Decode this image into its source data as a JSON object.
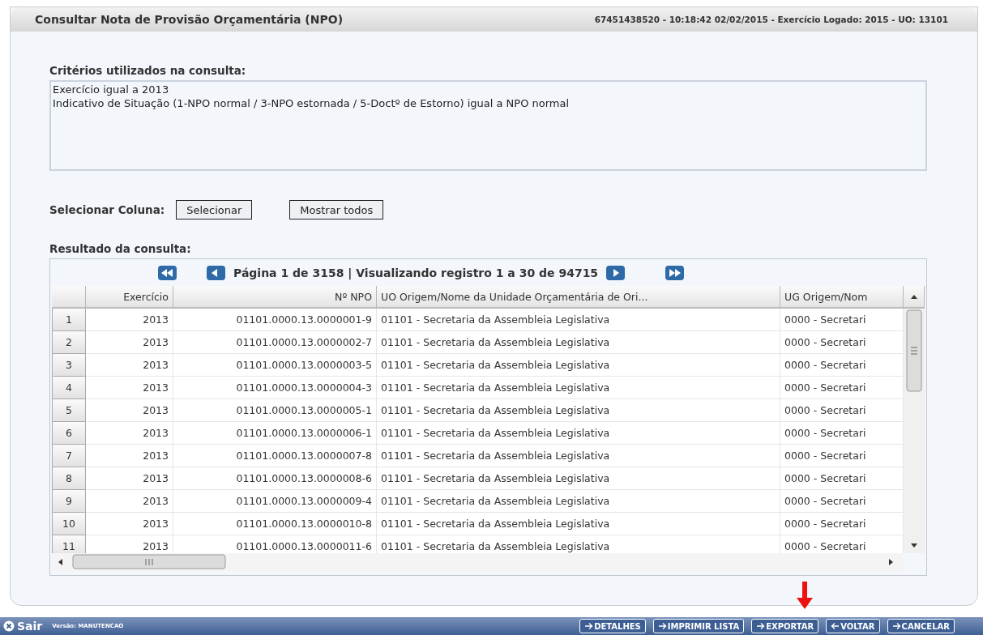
{
  "header": {
    "title": "Consultar Nota de Provisão Orçamentária (NPO)",
    "info": "67451438520 - 10:18:42 02/02/2015 - Exercício Logado: 2015 - UO: 13101"
  },
  "criteria": {
    "label": "Critérios utilizados na consulta:",
    "lines": [
      "Exercício igual a 2013",
      "Indicativo de Situação (1-NPO normal / 3-NPO estornada / 5-Doctº de Estorno) igual a NPO normal"
    ]
  },
  "column_select": {
    "label": "Selecionar Coluna:",
    "buttons": [
      "Selecionar",
      "Mostrar todos"
    ]
  },
  "result": {
    "label": "Resultado da consulta:",
    "pagination": "Página 1 de 3158 | Visualizando registro 1 a 30 de 94715",
    "columns": [
      "Exercício",
      "Nº NPO",
      "UO Origem/Nome da Unidade Orçamentária de Ori...",
      "UG Origem/Nom"
    ],
    "rows": [
      {
        "num": "1",
        "cells": [
          "2013",
          "01101.0000.13.0000001-9",
          "01101 - Secretaria da Assembleia Legislativa",
          "0000 - Secretari"
        ]
      },
      {
        "num": "2",
        "cells": [
          "2013",
          "01101.0000.13.0000002-7",
          "01101 - Secretaria da Assembleia Legislativa",
          "0000 - Secretari"
        ]
      },
      {
        "num": "3",
        "cells": [
          "2013",
          "01101.0000.13.0000003-5",
          "01101 - Secretaria da Assembleia Legislativa",
          "0000 - Secretari"
        ]
      },
      {
        "num": "4",
        "cells": [
          "2013",
          "01101.0000.13.0000004-3",
          "01101 - Secretaria da Assembleia Legislativa",
          "0000 - Secretari"
        ]
      },
      {
        "num": "5",
        "cells": [
          "2013",
          "01101.0000.13.0000005-1",
          "01101 - Secretaria da Assembleia Legislativa",
          "0000 - Secretari"
        ]
      },
      {
        "num": "6",
        "cells": [
          "2013",
          "01101.0000.13.0000006-1",
          "01101 - Secretaria da Assembleia Legislativa",
          "0000 - Secretari"
        ]
      },
      {
        "num": "7",
        "cells": [
          "2013",
          "01101.0000.13.0000007-8",
          "01101 - Secretaria da Assembleia Legislativa",
          "0000 - Secretari"
        ]
      },
      {
        "num": "8",
        "cells": [
          "2013",
          "01101.0000.13.0000008-6",
          "01101 - Secretaria da Assembleia Legislativa",
          "0000 - Secretari"
        ]
      },
      {
        "num": "9",
        "cells": [
          "2013",
          "01101.0000.13.0000009-4",
          "01101 - Secretaria da Assembleia Legislativa",
          "0000 - Secretari"
        ]
      },
      {
        "num": "10",
        "cells": [
          "2013",
          "01101.0000.13.0000010-8",
          "01101 - Secretaria da Assembleia Legislativa",
          "0000 - Secretari"
        ]
      },
      {
        "num": "11",
        "cells": [
          "2013",
          "01101.0000.13.0000011-6",
          "01101 - Secretaria da Assembleia Legislativa",
          "0000 - Secretari"
        ]
      }
    ]
  },
  "footer": {
    "exit": "Sair",
    "version": "Versão: MANUTENCAO",
    "buttons": [
      {
        "label": "DETALHES",
        "kind": "forward"
      },
      {
        "label": "IMPRIMIR LISTA",
        "kind": "forward"
      },
      {
        "label": "EXPORTAR",
        "kind": "forward"
      },
      {
        "label": "VOLTAR",
        "kind": "back"
      },
      {
        "label": "CANCELAR",
        "kind": "forward"
      }
    ]
  }
}
